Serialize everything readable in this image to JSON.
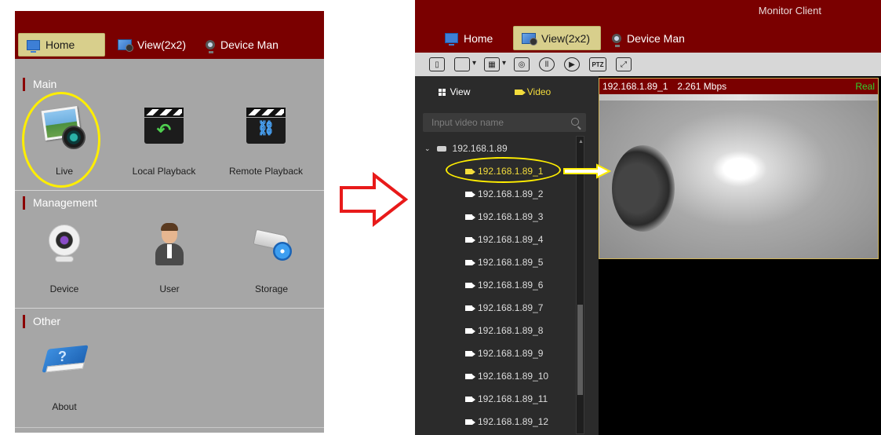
{
  "left": {
    "tabs": [
      {
        "label": "Home",
        "active": true,
        "icon": "monitor-icon"
      },
      {
        "label": "View(2x2)",
        "active": false,
        "icon": "view-layout-icon"
      },
      {
        "label": "Device Man",
        "active": false,
        "icon": "webcam-icon"
      }
    ],
    "sections": [
      {
        "title": "Main",
        "items": [
          {
            "label": "Live",
            "icon": "live-camera-icon"
          },
          {
            "label": "Local Playback",
            "icon": "local-playback-clapper-icon"
          },
          {
            "label": "Remote Playback",
            "icon": "remote-playback-clapper-icon"
          }
        ]
      },
      {
        "title": "Management",
        "items": [
          {
            "label": "Device",
            "icon": "device-webcam-icon"
          },
          {
            "label": "User",
            "icon": "user-avatar-icon"
          },
          {
            "label": "Storage",
            "icon": "storage-camera-icon"
          }
        ]
      },
      {
        "title": "Other",
        "items": [
          {
            "label": "About",
            "icon": "about-book-icon"
          }
        ]
      }
    ]
  },
  "right": {
    "app_title": "Monitor Client",
    "tabs": [
      {
        "label": "Home",
        "active": false,
        "icon": "monitor-icon"
      },
      {
        "label": "View(2x2)",
        "active": true,
        "icon": "view-layout-icon"
      },
      {
        "label": "Device Man",
        "active": false,
        "icon": "webcam-icon"
      }
    ],
    "toolbar": {
      "ptz_label": "PTZ",
      "icons": [
        "screen-swap-icon",
        "single-window-icon",
        "split-layout-icon",
        "snapshot-icon",
        "pause-icon",
        "play-icon",
        "ptz-icon",
        "fullscreen-icon"
      ]
    },
    "sidebar": {
      "tabs": [
        {
          "label": "View",
          "active": false,
          "icon": "grid-icon"
        },
        {
          "label": "Video",
          "active": true,
          "icon": "video-camera-icon"
        }
      ],
      "search": {
        "placeholder": "Input video name"
      },
      "tree": {
        "root": "192.168.1.89",
        "items": [
          {
            "label": "192.168.1.89_1",
            "selected": true
          },
          {
            "label": "192.168.1.89_2"
          },
          {
            "label": "192.168.1.89_3"
          },
          {
            "label": "192.168.1.89_4"
          },
          {
            "label": "192.168.1.89_5"
          },
          {
            "label": "192.168.1.89_6"
          },
          {
            "label": "192.168.1.89_7"
          },
          {
            "label": "192.168.1.89_8"
          },
          {
            "label": "192.168.1.89_9"
          },
          {
            "label": "192.168.1.89_10"
          },
          {
            "label": "192.168.1.89_11"
          },
          {
            "label": "192.168.1.89_12"
          }
        ]
      }
    },
    "video": {
      "channel": "192.168.1.89_1",
      "bitrate": "2.261 Mbps",
      "mode": "Real"
    }
  },
  "colors": {
    "header_red": "#7a0000",
    "active_tab": "#d8cf8c",
    "selected_yellow": "#f3dc3c",
    "annotation_yellow": "#ffee00",
    "arrow_red": "#e81a1a",
    "real_green": "#2fd42f"
  }
}
